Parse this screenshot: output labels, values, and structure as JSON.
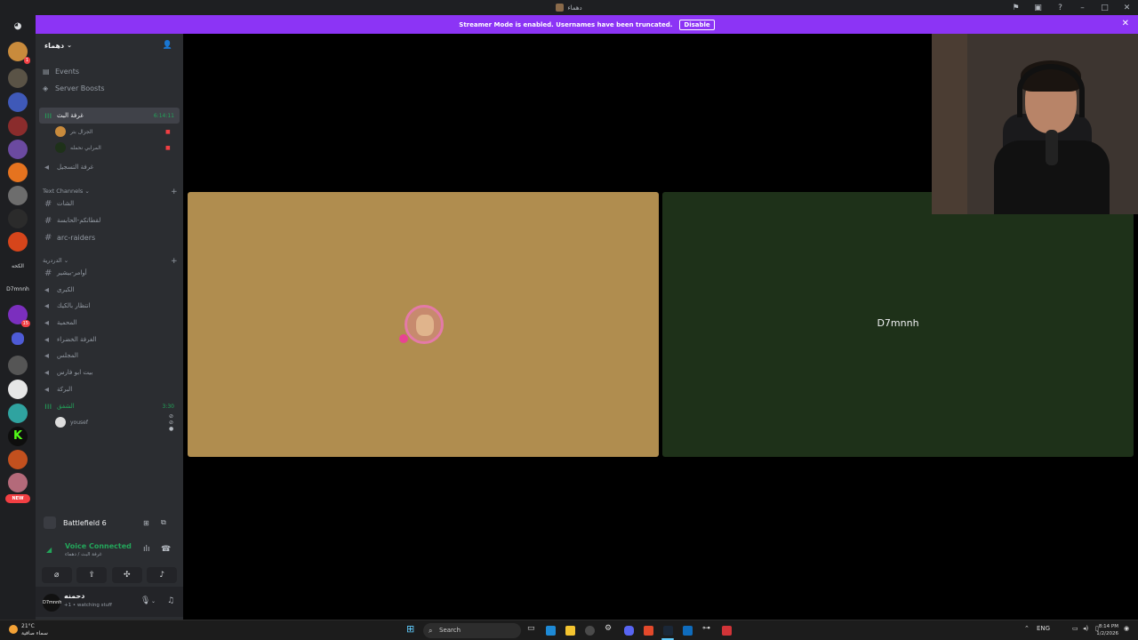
{
  "window": {
    "title": "دهماء",
    "controls": [
      "flag-icon",
      "screen-icon",
      "help-icon",
      "minimize-icon",
      "maximize-icon",
      "close-icon"
    ]
  },
  "banner": {
    "text": "Streamer Mode is enabled. Usernames have been truncated.",
    "button": "Disable",
    "color": "#8c34f5"
  },
  "guilds": {
    "badges": {
      "first": "1",
      "purple": "1",
      "second_purple": "15"
    },
    "text_items": [
      "الكحه",
      "D7mnnh"
    ],
    "new_label": "NEW"
  },
  "server": {
    "name": "دهماء",
    "menu": [
      {
        "label": "Events"
      },
      {
        "label": "Server Boosts"
      }
    ],
    "voice_active": {
      "name": "غرفة البث",
      "timer": "6:14:11"
    },
    "voice_users_1": [
      {
        "name": "الجزال بتر"
      },
      {
        "name": "المرابي نحمله"
      }
    ],
    "record_channel": "غرفة التسجيل",
    "text_category": "Text Channels",
    "text_channels": [
      {
        "name": "الشات"
      },
      {
        "name": "لقطاتكم-الحابسة"
      },
      {
        "name": "arc-raiders"
      }
    ],
    "voice_category": "الدردرية",
    "voice_channels": [
      {
        "name": "أوامر-بيشير"
      },
      {
        "name": "الكبرى"
      },
      {
        "name": "انتظار بالكيك"
      },
      {
        "name": "المحمية"
      },
      {
        "name": "الغرفة الخضراء"
      },
      {
        "name": "المجلس"
      },
      {
        "name": "بيت ابو فارس"
      },
      {
        "name": "البركة"
      }
    ],
    "voice_active_2": {
      "name": "الشفق",
      "timer": "3:30"
    },
    "voice_users_2": [
      {
        "name": "yousef"
      }
    ]
  },
  "panel": {
    "game": "Battlefield 6",
    "voice_status": "Voice Connected",
    "voice_location": "غرفة البث / دهماء",
    "user_name": "دحمنه",
    "user_status": "+1 • watching stuff",
    "avatar_text": "D7mnnh"
  },
  "stage": {
    "tile2_name": "D7mnnh",
    "tile1_color": "#b08d4f",
    "tile2_color": "#1e3119"
  },
  "taskbar": {
    "weather_temp": "21°C",
    "weather_desc": "سماء صافية",
    "search": "Search",
    "lang": "ENG",
    "time": "8:14 PM",
    "date": "1/2/2026"
  }
}
